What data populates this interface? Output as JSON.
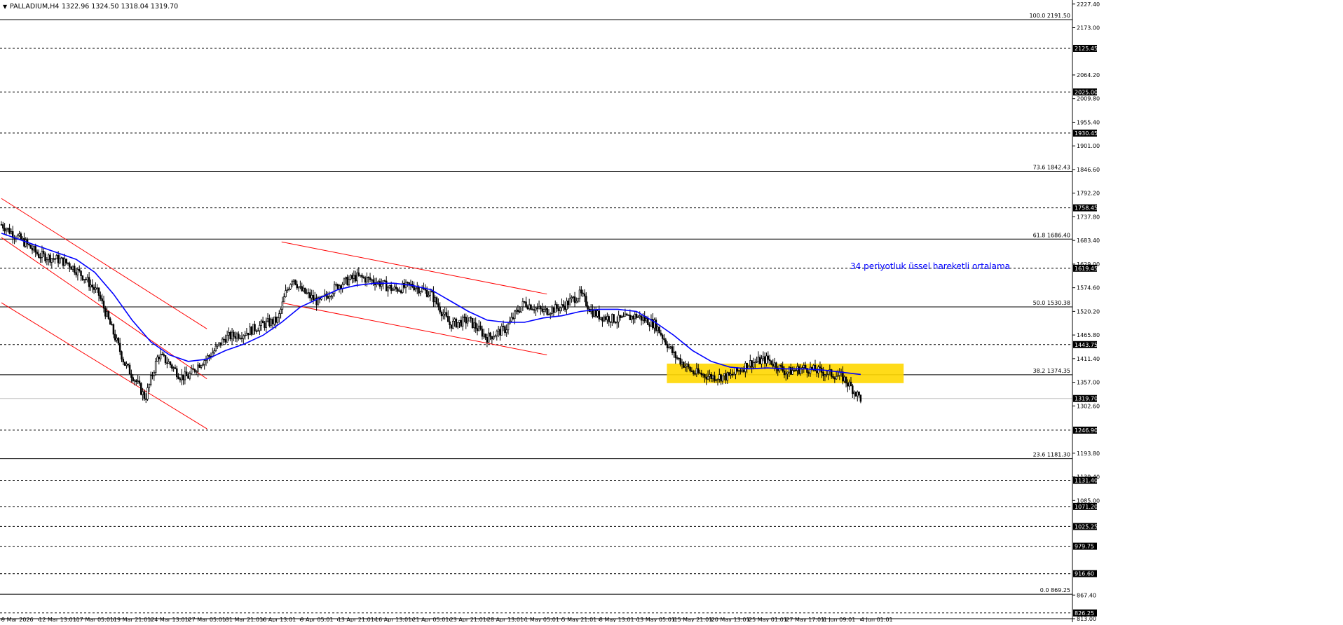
{
  "header": {
    "symbol_label": "PALLADIUM,H4",
    "ohlc": "1322.96 1324.50 1318.04 1319.70",
    "menu_glyph": "▼"
  },
  "colors": {
    "background": "#ffffff",
    "candle": "#000000",
    "ema": "#0000ff",
    "channel": "#ff0000",
    "zone": "#ffd700",
    "hline": "#000000",
    "annotation": "#0000ff"
  },
  "chart_data": {
    "type": "candlestick",
    "symbol": "PALLADIUM",
    "timeframe": "H4",
    "ylim": [
      813,
      2227
    ],
    "y_axis_ticks": [
      "2227.40",
      "2173.00",
      "2064.20",
      "2009.80",
      "1955.40",
      "1901.00",
      "1846.60",
      "1792.20",
      "1737.80",
      "1683.40",
      "1629.00",
      "1574.60",
      "1520.20",
      "1465.80",
      "1411.40",
      "1357.00",
      "1302.60",
      "1193.80",
      "1139.40",
      "1085.00",
      "867.40",
      "813.00"
    ],
    "x_axis_ticks": [
      "9 Mar 2026",
      "12 Mar 13:01",
      "17 Mar 05:01",
      "19 Mar 21:01",
      "24 Mar 13:01",
      "27 Mar 05:01",
      "31 Mar 21:01",
      "6 Apr 13:01",
      "9 Apr 05:01",
      "13 Apr 21:01",
      "16 Apr 13:01",
      "21 Apr 05:01",
      "23 Apr 21:01",
      "28 Apr 13:01",
      "1 May 05:01",
      "5 May 21:01",
      "8 May 13:01",
      "13 May 05:01",
      "15 May 21:01",
      "20 May 13:01",
      "25 May 01:01",
      "27 May 17:01",
      "1 Jun 09:01",
      "4 Jun 01:01"
    ],
    "current_price": 1319.7,
    "fib_levels": [
      {
        "label": "100.0 2191.50",
        "value": 2191.5
      },
      {
        "label": "73.6 1842.43",
        "value": 1842.43
      },
      {
        "label": "61.8 1686.40",
        "value": 1686.4
      },
      {
        "label": "50.0 1530.38",
        "value": 1530.38
      },
      {
        "label": "38.2 1374.35",
        "value": 1374.35
      },
      {
        "label": "23.6 1181.30",
        "value": 1181.3
      },
      {
        "label": "0.0 869.25",
        "value": 869.25
      }
    ],
    "horizontal_levels": [
      {
        "label": "2125.45",
        "value": 2125.45
      },
      {
        "label": "2025.00",
        "value": 2025.0
      },
      {
        "label": "1930.45",
        "value": 1930.45
      },
      {
        "label": "1758.45",
        "value": 1758.45
      },
      {
        "label": "1619.45",
        "value": 1619.45
      },
      {
        "label": "1443.75",
        "value": 1443.75
      },
      {
        "label": "1319.70",
        "value": 1319.7
      },
      {
        "label": "1246.90",
        "value": 1246.9
      },
      {
        "label": "1131.40",
        "value": 1131.4
      },
      {
        "label": "1071.20",
        "value": 1071.2
      },
      {
        "label": "1025.25",
        "value": 1025.25
      },
      {
        "label": "979.75",
        "value": 979.75
      },
      {
        "label": "916.60",
        "value": 916.6
      },
      {
        "label": "826.25",
        "value": 826.25
      }
    ],
    "zone": {
      "top": 1400,
      "bottom": 1355,
      "start_tick": 18,
      "end_tick": 24
    },
    "ema_label": "34 periyotluk üssel hareketli ortalama",
    "price_path": [
      [
        0.0,
        1720
      ],
      [
        0.6,
        1680
      ],
      [
        1.0,
        1650
      ],
      [
        1.5,
        1640
      ],
      [
        1.8,
        1630
      ],
      [
        2.2,
        1600
      ],
      [
        2.6,
        1560
      ],
      [
        3.0,
        1470
      ],
      [
        3.3,
        1400
      ],
      [
        3.6,
        1360
      ],
      [
        3.85,
        1320
      ],
      [
        4.2,
        1420
      ],
      [
        4.5,
        1400
      ],
      [
        4.8,
        1370
      ],
      [
        5.0,
        1370
      ],
      [
        5.3,
        1400
      ],
      [
        5.6,
        1420
      ],
      [
        6.0,
        1460
      ],
      [
        6.5,
        1470
      ],
      [
        7.0,
        1490
      ],
      [
        7.4,
        1500
      ],
      [
        7.6,
        1560
      ],
      [
        7.8,
        1600
      ],
      [
        8.0,
        1570
      ],
      [
        8.5,
        1540
      ],
      [
        9.0,
        1580
      ],
      [
        9.5,
        1600
      ],
      [
        10.0,
        1590
      ],
      [
        10.5,
        1570
      ],
      [
        11.0,
        1580
      ],
      [
        11.5,
        1560
      ],
      [
        12.0,
        1490
      ],
      [
        12.5,
        1500
      ],
      [
        13.0,
        1460
      ],
      [
        13.5,
        1480
      ],
      [
        13.8,
        1520
      ],
      [
        14.0,
        1540
      ],
      [
        14.5,
        1520
      ],
      [
        15.0,
        1530
      ],
      [
        15.5,
        1560
      ],
      [
        15.8,
        1520
      ],
      [
        16.0,
        1510
      ],
      [
        16.5,
        1500
      ],
      [
        17.0,
        1510
      ],
      [
        17.5,
        1490
      ],
      [
        18.0,
        1420
      ],
      [
        18.5,
        1380
      ],
      [
        19.0,
        1370
      ],
      [
        19.5,
        1370
      ],
      [
        20.0,
        1400
      ],
      [
        20.5,
        1410
      ],
      [
        21.0,
        1380
      ],
      [
        21.5,
        1390
      ],
      [
        22.0,
        1380
      ],
      [
        22.5,
        1370
      ],
      [
        22.8,
        1340
      ],
      [
        23.0,
        1320
      ]
    ],
    "ema_path": [
      [
        0.0,
        1700
      ],
      [
        1.0,
        1670
      ],
      [
        2.0,
        1640
      ],
      [
        2.5,
        1610
      ],
      [
        3.0,
        1560
      ],
      [
        3.5,
        1500
      ],
      [
        4.0,
        1450
      ],
      [
        4.5,
        1420
      ],
      [
        5.0,
        1405
      ],
      [
        5.5,
        1410
      ],
      [
        6.0,
        1430
      ],
      [
        6.5,
        1445
      ],
      [
        7.0,
        1465
      ],
      [
        7.5,
        1495
      ],
      [
        8.0,
        1530
      ],
      [
        8.5,
        1550
      ],
      [
        9.0,
        1570
      ],
      [
        9.5,
        1580
      ],
      [
        10.0,
        1585
      ],
      [
        10.5,
        1585
      ],
      [
        11.0,
        1580
      ],
      [
        11.5,
        1570
      ],
      [
        12.0,
        1545
      ],
      [
        12.5,
        1520
      ],
      [
        13.0,
        1500
      ],
      [
        13.5,
        1495
      ],
      [
        14.0,
        1495
      ],
      [
        14.5,
        1505
      ],
      [
        15.0,
        1510
      ],
      [
        15.5,
        1520
      ],
      [
        16.0,
        1525
      ],
      [
        16.5,
        1525
      ],
      [
        17.0,
        1520
      ],
      [
        17.5,
        1495
      ],
      [
        18.0,
        1465
      ],
      [
        18.5,
        1430
      ],
      [
        19.0,
        1405
      ],
      [
        19.5,
        1392
      ],
      [
        20.0,
        1388
      ],
      [
        20.5,
        1390
      ],
      [
        21.0,
        1388
      ],
      [
        21.5,
        1388
      ],
      [
        22.0,
        1385
      ],
      [
        22.5,
        1380
      ],
      [
        23.0,
        1375
      ]
    ],
    "channels": [
      {
        "start": [
          0.0,
          1780
        ],
        "end": [
          5.5,
          1480
        ]
      },
      {
        "start": [
          0.0,
          1690
        ],
        "end": [
          5.5,
          1365
        ]
      },
      {
        "start": [
          0.0,
          1540
        ],
        "end": [
          5.5,
          1250
        ]
      },
      {
        "start": [
          7.5,
          1680
        ],
        "end": [
          14.6,
          1560
        ]
      },
      {
        "start": [
          7.5,
          1540
        ],
        "end": [
          14.6,
          1420
        ]
      }
    ]
  }
}
